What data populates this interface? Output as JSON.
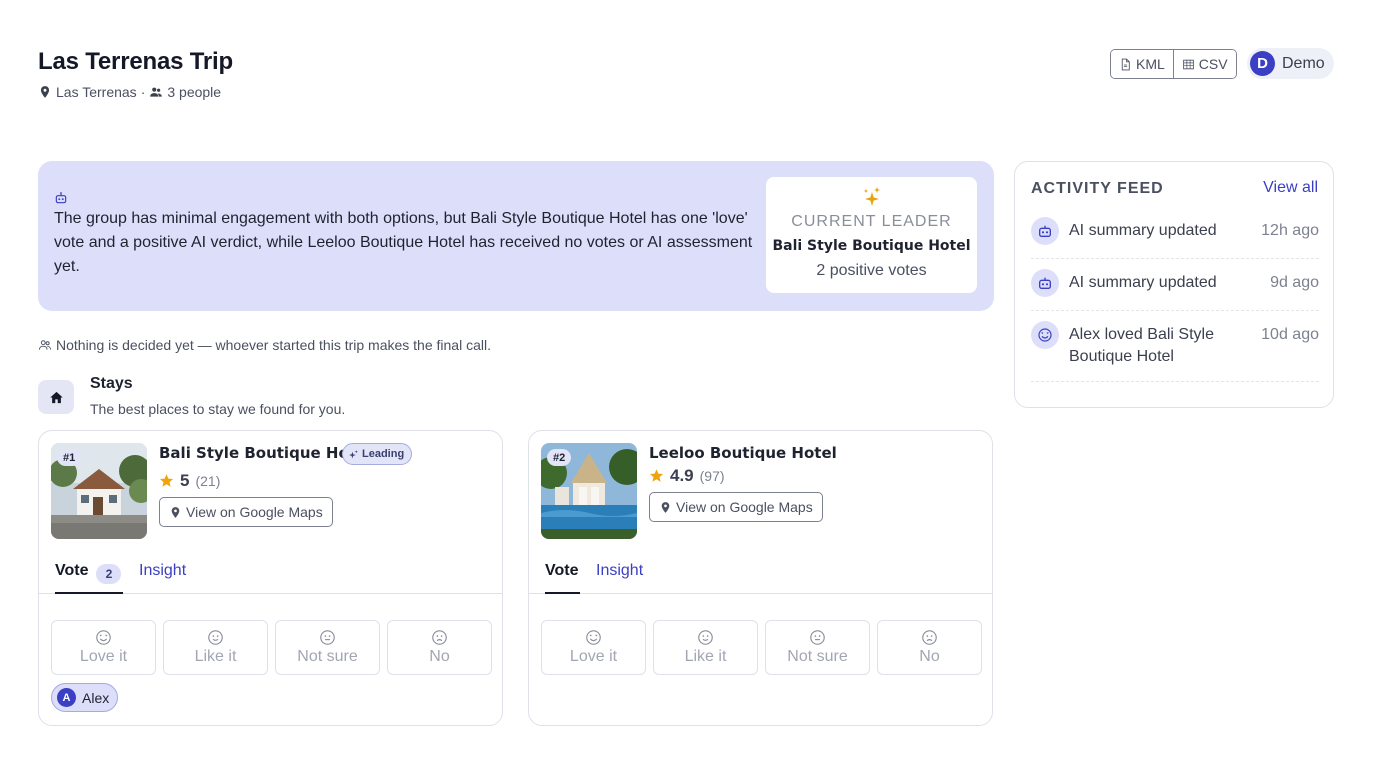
{
  "header": {
    "title": "Las Terrenas Trip",
    "location": "Las Terrenas",
    "separator": "·",
    "people": "3 people",
    "export_kml": "KML",
    "export_csv": "CSV",
    "user_initial": "D",
    "user_name": "Demo"
  },
  "summary": {
    "text": "The group has minimal engagement with both options, but Bali Style Boutique Hotel has one 'love' vote and a positive AI verdict, while Leeloo Boutique Hotel has received no votes or AI assessment yet.",
    "leader_label": "CURRENT LEADER",
    "leader_name": "Bali Style Boutique Hotel",
    "leader_votes": "2 positive votes"
  },
  "decision_note": "Nothing is decided yet — whoever started this trip makes the final call.",
  "section": {
    "title": "Stays",
    "subtitle": "The best places to stay we found for you."
  },
  "stays": [
    {
      "rank": "#1",
      "name": "Bali Style Boutique Hotel",
      "badge": "Leading",
      "score": "5",
      "reviews": "(21)",
      "maps_label": "View on Google Maps",
      "tab_vote": "Vote",
      "vote_count": "2",
      "tab_insight": "Insight",
      "voter_initial": "A",
      "voter_name": "Alex"
    },
    {
      "rank": "#2",
      "name": "Leeloo Boutique Hotel",
      "score": "4.9",
      "reviews": "(97)",
      "maps_label": "View on Google Maps",
      "tab_vote": "Vote",
      "tab_insight": "Insight"
    }
  ],
  "vote_options": {
    "love": "Love it",
    "like": "Like it",
    "unsure": "Not sure",
    "no": "No"
  },
  "feed": {
    "title": "ACTIVITY FEED",
    "view_all": "View all",
    "items": [
      {
        "text": "AI summary updated",
        "time": "12h ago",
        "icon": "robot-icon"
      },
      {
        "text": "AI summary updated",
        "time": "9d ago",
        "icon": "robot-icon"
      },
      {
        "text": "Alex loved Bali Style Boutique Hotel",
        "time": "10d ago",
        "icon": "love-face-icon"
      }
    ]
  },
  "colors": {
    "accent": "#3a3fc4",
    "summary_bg": "#dcdefa",
    "star": "#f0a30a"
  }
}
